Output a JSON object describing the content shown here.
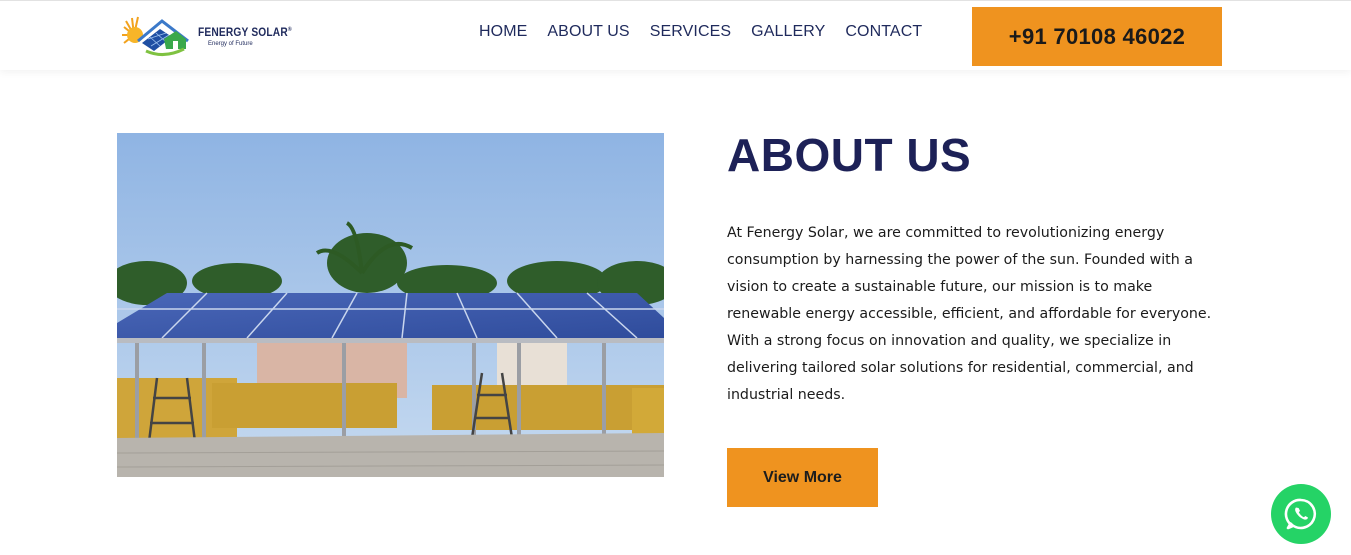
{
  "header": {
    "logo": {
      "name": "FENERGY SOLAR",
      "registered": "®",
      "tagline": "Energy of Future"
    },
    "nav": [
      {
        "label": "HOME"
      },
      {
        "label": "ABOUT US"
      },
      {
        "label": "SERVICES"
      },
      {
        "label": "GALLERY"
      },
      {
        "label": "CONTACT"
      }
    ],
    "phone": "+91 70108 46022"
  },
  "about": {
    "title": "ABOUT US",
    "body": "At Fenergy Solar, we are committed to revolutionizing energy consumption by harnessing the power of the sun. Founded with a vision to create a sustainable future, our mission is to make renewable energy accessible, efficient, and affordable for everyone. With a strong focus on innovation and quality, we specialize in delivering tailored solar solutions for residential, commercial, and industrial needs.",
    "button": "View More"
  },
  "icons": {
    "logo": "sun-house-solar-logo-icon",
    "whatsapp": "whatsapp-icon"
  },
  "colors": {
    "accent": "#ef931f",
    "navy": "#1d2157",
    "whatsapp": "#25d366"
  }
}
